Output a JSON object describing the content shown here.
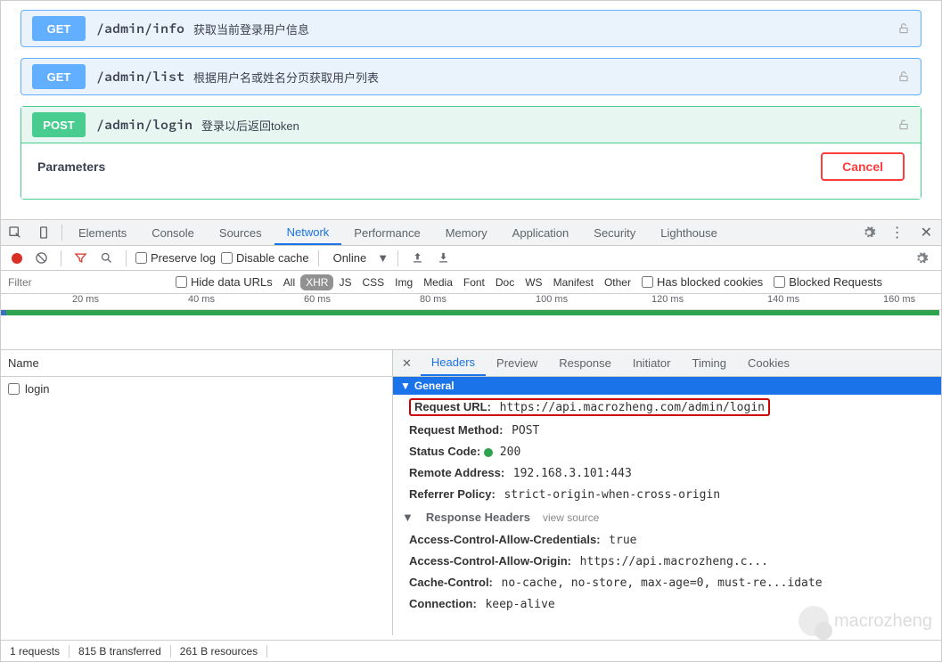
{
  "ops": [
    {
      "method": "GET",
      "path": "/admin/info",
      "desc": "获取当前登录用户信息"
    },
    {
      "method": "GET",
      "path": "/admin/list",
      "desc": "根据用户名或姓名分页获取用户列表"
    },
    {
      "method": "POST",
      "path": "/admin/login",
      "desc": "登录以后返回token"
    }
  ],
  "params_title": "Parameters",
  "cancel": "Cancel",
  "devtabs": [
    "Elements",
    "Console",
    "Sources",
    "Network",
    "Performance",
    "Memory",
    "Application",
    "Security",
    "Lighthouse"
  ],
  "devtab_active": "Network",
  "toolbar": {
    "preserve": "Preserve log",
    "disable": "Disable cache",
    "throttling": "Online"
  },
  "filter": {
    "placeholder": "Filter",
    "hide": "Hide data URLs",
    "types": [
      "All",
      "XHR",
      "JS",
      "CSS",
      "Img",
      "Media",
      "Font",
      "Doc",
      "WS",
      "Manifest",
      "Other"
    ],
    "active": "XHR",
    "blocked_cookies": "Has blocked cookies",
    "blocked_req": "Blocked Requests"
  },
  "ticks": [
    "20 ms",
    "40 ms",
    "60 ms",
    "80 ms",
    "100 ms",
    "120 ms",
    "140 ms",
    "160 ms"
  ],
  "left_hdr": "Name",
  "requests": [
    "login"
  ],
  "subtabs": [
    "Headers",
    "Preview",
    "Response",
    "Initiator",
    "Timing",
    "Cookies"
  ],
  "subtab_active": "Headers",
  "general_title": "General",
  "general": [
    {
      "k": "Request URL:",
      "v": "https://api.macrozheng.com/admin/login",
      "hl": true
    },
    {
      "k": "Request Method:",
      "v": "POST"
    },
    {
      "k": "Status Code:",
      "v": "200",
      "dot": true
    },
    {
      "k": "Remote Address:",
      "v": "192.168.3.101:443"
    },
    {
      "k": "Referrer Policy:",
      "v": "strict-origin-when-cross-origin"
    }
  ],
  "resp_hdr": "Response Headers",
  "view_source": "view source",
  "resp": [
    {
      "k": "Access-Control-Allow-Credentials:",
      "v": "true"
    },
    {
      "k": "Access-Control-Allow-Origin:",
      "v": "https://api.macrozheng.c..."
    },
    {
      "k": "Cache-Control:",
      "v": "no-cache, no-store, max-age=0, must-re...idate"
    },
    {
      "k": "Connection:",
      "v": "keep-alive"
    }
  ],
  "status": {
    "req": "1 requests",
    "transferred": "815 B transferred",
    "resources": "261 B resources"
  },
  "watermark": "macrozheng"
}
